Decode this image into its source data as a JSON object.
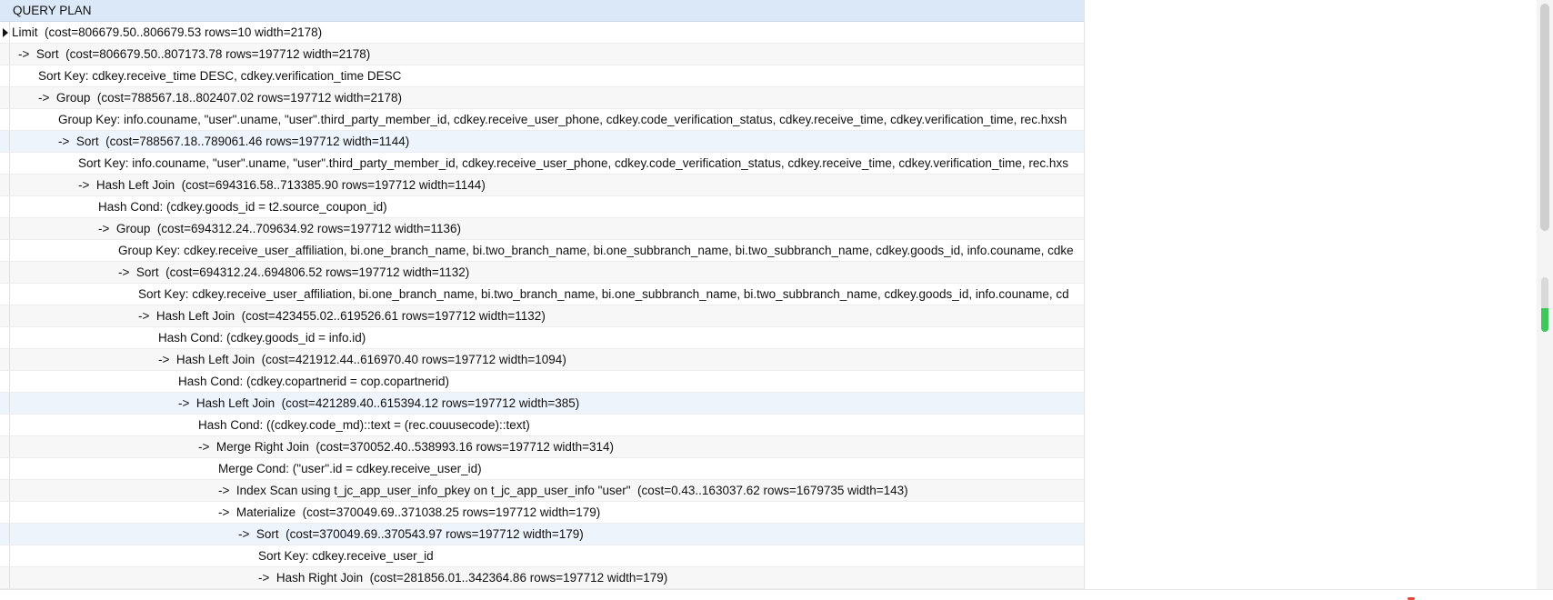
{
  "grid": {
    "column_header": "QUERY PLAN",
    "rows": [
      "Limit  (cost=806679.50..806679.53 rows=10 width=2178)",
      "->  Sort  (cost=806679.50..807173.78 rows=197712 width=2178)",
      "Sort Key: cdkey.receive_time DESC, cdkey.verification_time DESC",
      "->  Group  (cost=788567.18..802407.02 rows=197712 width=2178)",
      "Group Key: info.couname, \"user\".uname, \"user\".third_party_member_id, cdkey.receive_user_phone, cdkey.code_verification_status, cdkey.receive_time, cdkey.verification_time, rec.hxsh",
      "->  Sort  (cost=788567.18..789061.46 rows=197712 width=1144)",
      "Sort Key: info.couname, \"user\".uname, \"user\".third_party_member_id, cdkey.receive_user_phone, cdkey.code_verification_status, cdkey.receive_time, cdkey.verification_time, rec.hxs",
      "->  Hash Left Join  (cost=694316.58..713385.90 rows=197712 width=1144)",
      "Hash Cond: (cdkey.goods_id = t2.source_coupon_id)",
      "->  Group  (cost=694312.24..709634.92 rows=197712 width=1136)",
      "Group Key: cdkey.receive_user_affiliation, bi.one_branch_name, bi.two_branch_name, bi.one_subbranch_name, bi.two_subbranch_name, cdkey.goods_id, info.couname, cdke",
      "->  Sort  (cost=694312.24..694806.52 rows=197712 width=1132)",
      "Sort Key: cdkey.receive_user_affiliation, bi.one_branch_name, bi.two_branch_name, bi.one_subbranch_name, bi.two_subbranch_name, cdkey.goods_id, info.couname, cd",
      "->  Hash Left Join  (cost=423455.02..619526.61 rows=197712 width=1132)",
      "Hash Cond: (cdkey.goods_id = info.id)",
      "->  Hash Left Join  (cost=421912.44..616970.40 rows=197712 width=1094)",
      "Hash Cond: (cdkey.copartnerid = cop.copartnerid)",
      "->  Hash Left Join  (cost=421289.40..615394.12 rows=197712 width=385)",
      "Hash Cond: ((cdkey.code_md)::text = (rec.couusecode)::text)",
      "->  Merge Right Join  (cost=370052.40..538993.16 rows=197712 width=314)",
      "Merge Cond: (\"user\".id = cdkey.receive_user_id)",
      "->  Index Scan using t_jc_app_user_info_pkey on t_jc_app_user_info \"user\"  (cost=0.43..163037.62 rows=1679735 width=143)",
      "->  Materialize  (cost=370049.69..371038.25 rows=197712 width=179)",
      "->  Sort  (cost=370049.69..370543.97 rows=197712 width=179)",
      "Sort Key: cdkey.receive_user_id",
      "->  Hash Right Join  (cost=281856.01..342364.86 rows=197712 width=179)"
    ]
  },
  "ui": {
    "row_marker_icon": "current-row-triangle-icon"
  }
}
